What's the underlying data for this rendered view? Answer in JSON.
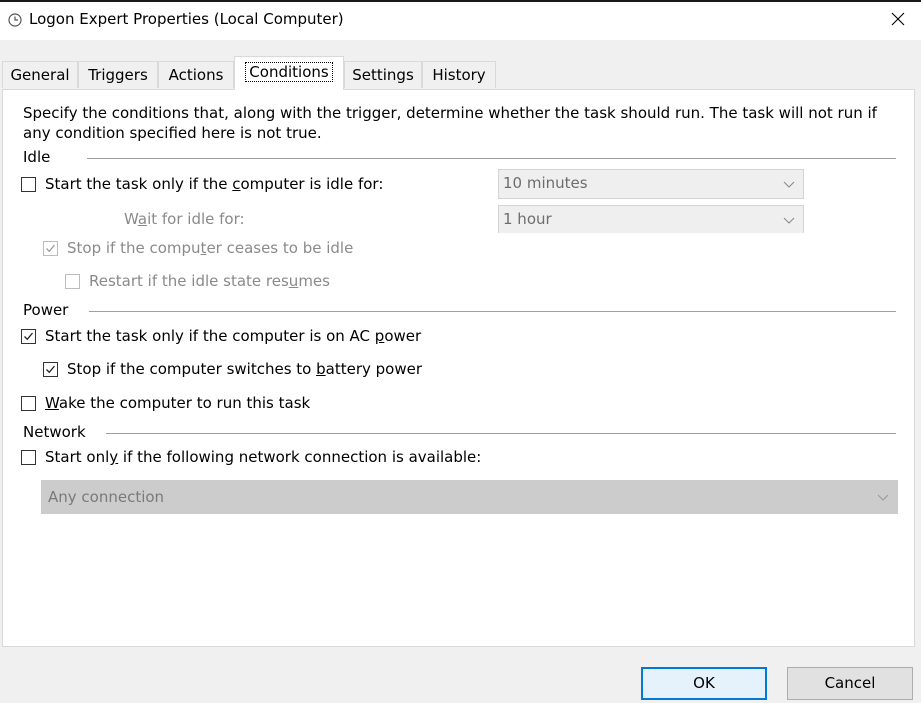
{
  "window": {
    "title": "Logon Expert Properties (Local Computer)"
  },
  "tabs": [
    {
      "label": "General"
    },
    {
      "label": "Triggers"
    },
    {
      "label": "Actions"
    },
    {
      "label": "Conditions",
      "active": true
    },
    {
      "label": "Settings"
    },
    {
      "label": "History"
    }
  ],
  "description": "Specify the conditions that, along with the trigger, determine whether the task should run.  The task will not run  if any condition specified here is not true.",
  "idle": {
    "group_label": "Idle",
    "start_if_idle": {
      "pre": "Start the task only if the ",
      "accel": "c",
      "post": "omputer is idle for:",
      "checked": false
    },
    "idle_duration": "10 minutes",
    "wait_label": {
      "pre": "W",
      "accel": "a",
      "post": "it for idle for:"
    },
    "wait_duration": "1 hour",
    "stop_if_not_idle": {
      "pre": "Stop if the compu",
      "accel": "t",
      "post": "er ceases to be idle",
      "checked": true,
      "disabled": true
    },
    "restart_if_idle": {
      "pre": "Restart if the idle state res",
      "accel": "u",
      "post": "mes",
      "checked": false,
      "disabled": true
    }
  },
  "power": {
    "group_label": "Power",
    "ac_power": {
      "pre": "Start the task only if the computer is on AC ",
      "accel": "p",
      "post": "ower",
      "checked": true
    },
    "battery_stop": {
      "pre": "Stop if the computer switches to ",
      "accel": "b",
      "post": "attery power",
      "checked": true
    },
    "wake": {
      "pre": "",
      "accel": "W",
      "post": "ake the computer to run this task",
      "checked": false
    }
  },
  "network": {
    "group_label": "Network",
    "start_if_network": {
      "pre": "Start onl",
      "accel": "y",
      "post": " if the following network connection is available:",
      "checked": false
    },
    "connection": "Any connection"
  },
  "buttons": {
    "ok": "OK",
    "cancel": "Cancel"
  },
  "colors": {
    "accent": "#0078d7",
    "panel_bg": "#ffffff",
    "dialog_bg": "#f0f0f0",
    "disabled_text": "#8a8a8a"
  }
}
